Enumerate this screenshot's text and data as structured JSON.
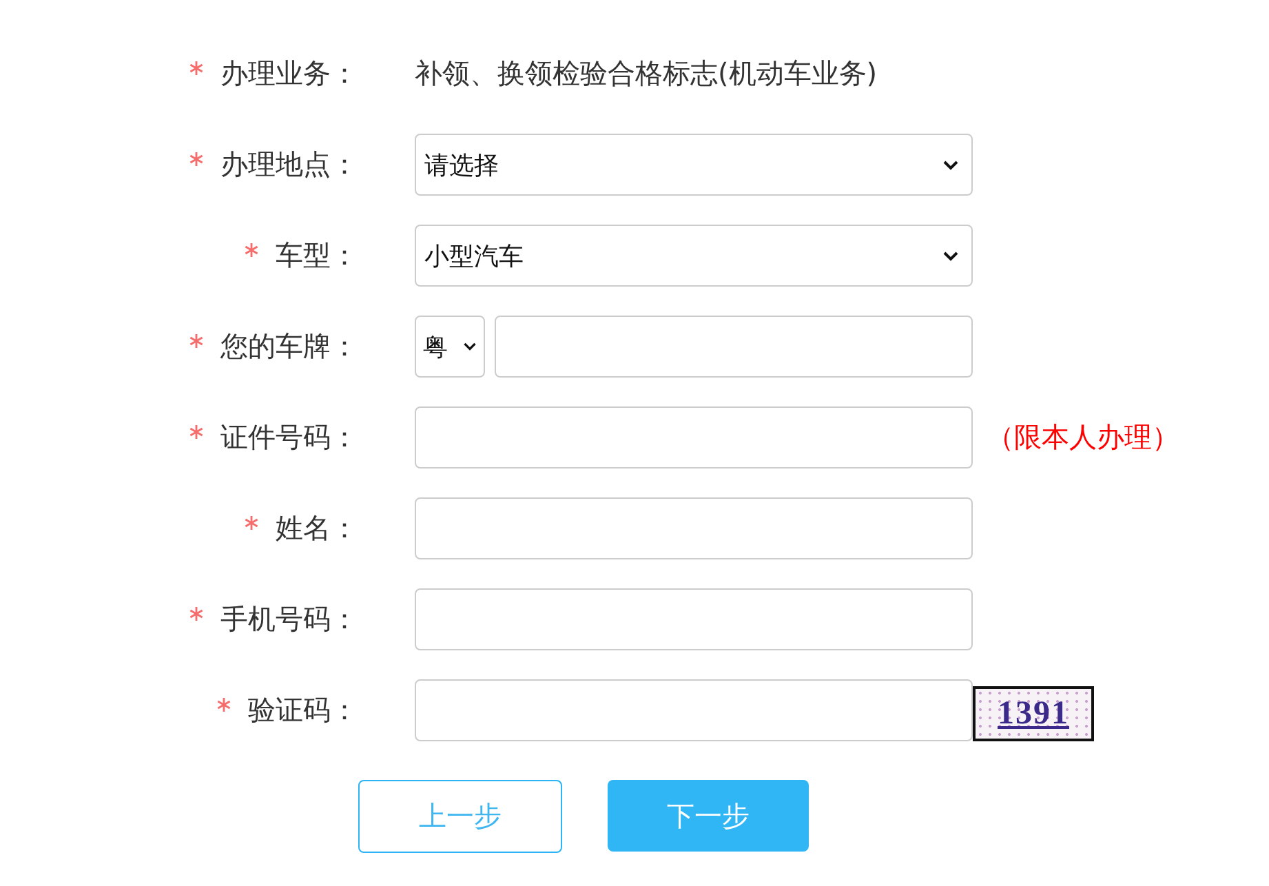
{
  "fields": [
    {
      "kind": "text",
      "label": "办理业务：",
      "required": true,
      "value": "补领、换领检验合格标志(机动车业务)"
    },
    {
      "kind": "select",
      "label": "办理地点：",
      "required": true,
      "value": "请选择"
    },
    {
      "kind": "select",
      "label": "车型：",
      "required": true,
      "value": "小型汽车"
    },
    {
      "kind": "plate",
      "label": "您的车牌：",
      "required": true,
      "prefix": "粤"
    },
    {
      "kind": "input",
      "label": "证件号码：",
      "required": true,
      "note": "（限本人办理）"
    },
    {
      "kind": "input",
      "label": "姓名：",
      "required": true
    },
    {
      "kind": "input",
      "label": "手机号码：",
      "required": true
    },
    {
      "kind": "captcha",
      "label": "验证码：",
      "required": true,
      "captcha": "1391"
    }
  ],
  "buttons": [
    {
      "kind": "secondary",
      "label": "上一步"
    },
    {
      "kind": "primary",
      "label": "下一步"
    }
  ]
}
